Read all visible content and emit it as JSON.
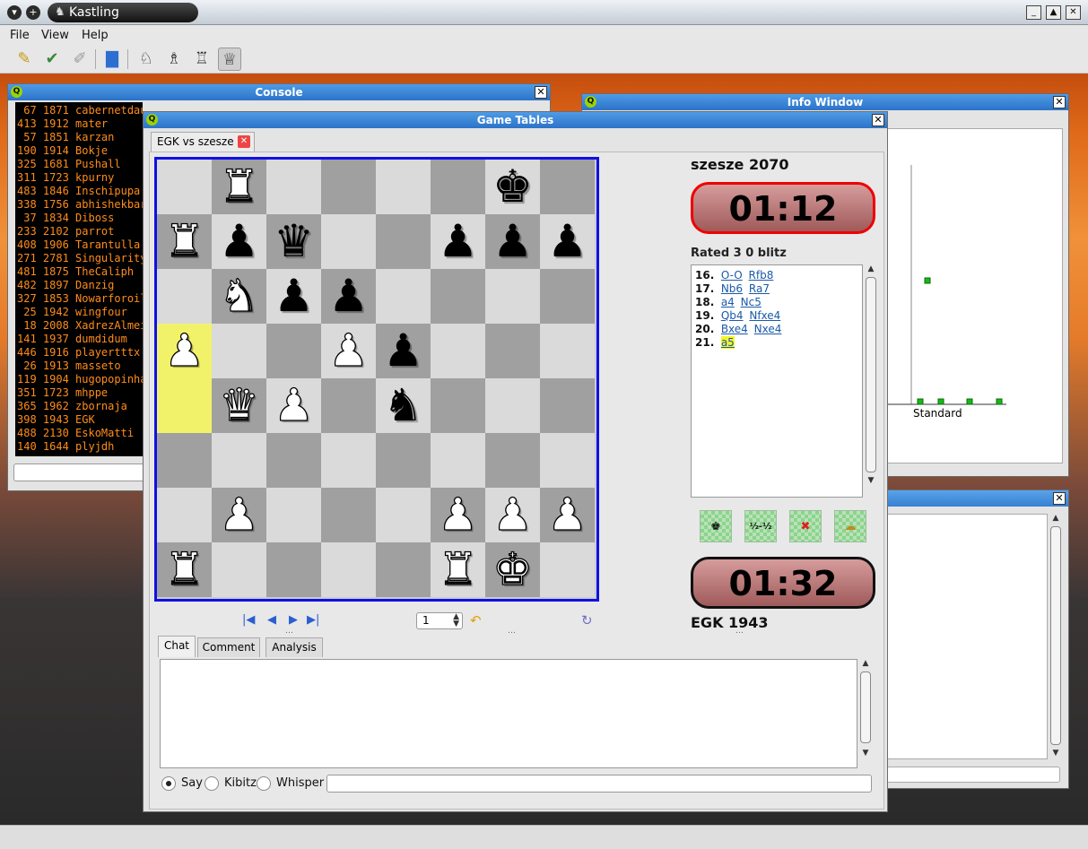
{
  "window": {
    "title": "Kastling"
  },
  "menu": [
    "File",
    "View",
    "Help"
  ],
  "console": {
    "title": "Console",
    "lines": [
      " 67 1871 cabernetdau",
      "413 1912 mater",
      " 57 1851 karzan",
      "190 1914 Bokje",
      "325 1681 Pushall",
      "311 1723 kpurny",
      "483 1846 Inschipupa",
      "338 1756 abhishekbar",
      " 37 1834 Diboss",
      "233 2102 parrot",
      "408 1906 Tarantulla",
      "271 2781 Singularity",
      "481 1875 TheCaliph",
      "482 1897 Danzig",
      "327 1853 Nowarforoil",
      " 25 1942 wingfour",
      " 18 2008 XadrezAlmei",
      "141 1937 dumdidum",
      "446 1916 playertttx",
      " 26 1913 masseto",
      "119 1904 hugopopinha",
      "351 1723 mhppe",
      "365 1962 zbornaja",
      "398 1943 EGK",
      "488 2130 EskoMatti",
      "140 1644 plyjdh"
    ]
  },
  "info_window": {
    "title": "Info Window",
    "axis_label": "Standard"
  },
  "game_tables": {
    "title": "Game Tables",
    "tab_label": "EGK vs szesze",
    "top_player": "szesze 2070",
    "bottom_player": "EGK 1943",
    "top_clock": "01:12",
    "bottom_clock": "01:32",
    "game_type": "Rated 3 0 blitz",
    "ply_value": "1",
    "moves": [
      {
        "num": "16.",
        "white": "O-O",
        "black": "Rfb8"
      },
      {
        "num": "17.",
        "white": "Nb6",
        "black": "Ra7"
      },
      {
        "num": "18.",
        "white": "a4",
        "black": "Nc5"
      },
      {
        "num": "19.",
        "white": "Qb4",
        "black": "Nfxe4"
      },
      {
        "num": "20.",
        "white": "Bxe4",
        "black": "Nxe4"
      },
      {
        "num": "21.",
        "white": "a5",
        "black": ""
      }
    ],
    "draw_label": "½-½",
    "subtabs": [
      "Chat",
      "Comment",
      "Analysis"
    ],
    "chat_modes": [
      "Say",
      "Kibitz",
      "Whisper"
    ]
  },
  "board": {
    "highlight": [
      "a5",
      "a4"
    ],
    "pieces": [
      {
        "sq": "b8",
        "glyph": "♜",
        "color": "white"
      },
      {
        "sq": "g8",
        "glyph": "♚",
        "color": "black"
      },
      {
        "sq": "a7",
        "glyph": "♜",
        "color": "white"
      },
      {
        "sq": "b7",
        "glyph": "♟",
        "color": "black"
      },
      {
        "sq": "c7",
        "glyph": "♛",
        "color": "black"
      },
      {
        "sq": "f7",
        "glyph": "♟",
        "color": "black"
      },
      {
        "sq": "g7",
        "glyph": "♟",
        "color": "black"
      },
      {
        "sq": "h7",
        "glyph": "♟",
        "color": "black"
      },
      {
        "sq": "b6",
        "glyph": "♞",
        "color": "white"
      },
      {
        "sq": "c6",
        "glyph": "♟",
        "color": "black"
      },
      {
        "sq": "d6",
        "glyph": "♟",
        "color": "black"
      },
      {
        "sq": "a5",
        "glyph": "♟",
        "color": "white"
      },
      {
        "sq": "d5",
        "glyph": "♟",
        "color": "white"
      },
      {
        "sq": "e5",
        "glyph": "♟",
        "color": "black"
      },
      {
        "sq": "b4",
        "glyph": "♛",
        "color": "white"
      },
      {
        "sq": "c4",
        "glyph": "♟",
        "color": "white"
      },
      {
        "sq": "e4",
        "glyph": "♞",
        "color": "black"
      },
      {
        "sq": "b2",
        "glyph": "♟",
        "color": "white"
      },
      {
        "sq": "f2",
        "glyph": "♟",
        "color": "white"
      },
      {
        "sq": "g2",
        "glyph": "♟",
        "color": "white"
      },
      {
        "sq": "h2",
        "glyph": "♟",
        "color": "white"
      },
      {
        "sq": "a1",
        "glyph": "♜",
        "color": "white"
      },
      {
        "sq": "f1",
        "glyph": "♜",
        "color": "white"
      },
      {
        "sq": "g1",
        "glyph": "♚",
        "color": "white"
      }
    ]
  }
}
